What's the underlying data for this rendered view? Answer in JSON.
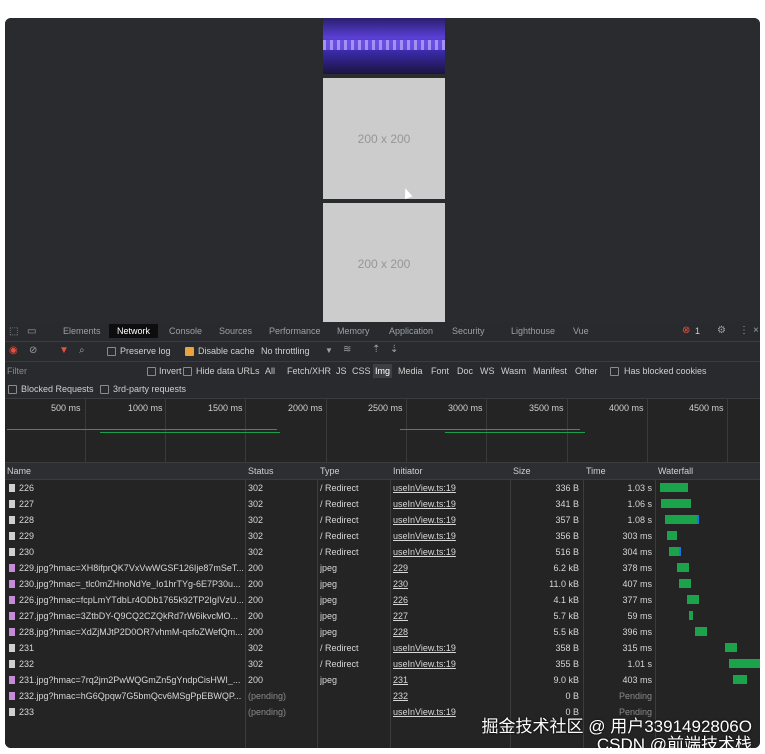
{
  "viewport": {
    "placeholder_1": "200 x 200",
    "placeholder_2": "200 x 200"
  },
  "devtools": {
    "tabs": [
      "Elements",
      "Network",
      "Console",
      "Sources",
      "Performance",
      "Memory",
      "Application",
      "Security",
      "Lighthouse",
      "Vue"
    ],
    "active_tab": "Network",
    "error_count": "1",
    "toolbar": {
      "preserve_log": "Preserve log",
      "disable_cache": "Disable cache",
      "throttling": "No throttling"
    },
    "filter": {
      "placeholder": "Filter",
      "invert": "Invert",
      "hide_data_urls": "Hide data URLs",
      "types": [
        "All",
        "Fetch/XHR",
        "JS",
        "CSS",
        "Img",
        "Media",
        "Font",
        "Doc",
        "WS",
        "Wasm",
        "Manifest",
        "Other"
      ],
      "active_type": "Img",
      "has_blocked_cookies": "Has blocked cookies",
      "blocked_requests": "Blocked Requests",
      "third_party": "3rd-party requests"
    },
    "overview_ticks": [
      "500 ms",
      "1000 ms",
      "1500 ms",
      "2000 ms",
      "2500 ms",
      "3000 ms",
      "3500 ms",
      "4000 ms",
      "4500 ms"
    ],
    "columns": {
      "name": "Name",
      "status": "Status",
      "type": "Type",
      "initiator": "Initiator",
      "size": "Size",
      "time": "Time",
      "waterfall": "Waterfall"
    },
    "rows": [
      {
        "name": "226",
        "status": "302",
        "type": "/ Redirect",
        "initiator": "useInView.ts:19",
        "size": "336 B",
        "time": "1.03 s",
        "icon": "document-icon"
      },
      {
        "name": "227",
        "status": "302",
        "type": "/ Redirect",
        "initiator": "useInView.ts:19",
        "size": "341 B",
        "time": "1.06 s",
        "icon": "document-icon"
      },
      {
        "name": "228",
        "status": "302",
        "type": "/ Redirect",
        "initiator": "useInView.ts:19",
        "size": "357 B",
        "time": "1.08 s",
        "icon": "document-icon"
      },
      {
        "name": "229",
        "status": "302",
        "type": "/ Redirect",
        "initiator": "useInView.ts:19",
        "size": "356 B",
        "time": "303 ms",
        "icon": "document-icon"
      },
      {
        "name": "230",
        "status": "302",
        "type": "/ Redirect",
        "initiator": "useInView.ts:19",
        "size": "516 B",
        "time": "304 ms",
        "icon": "document-icon"
      },
      {
        "name": "229.jpg?hmac=XH8ifprQK7VxVwWGSF126Ije87mSeT...",
        "status": "200",
        "type": "jpeg",
        "initiator": "229",
        "size": "6.2 kB",
        "time": "378 ms",
        "icon": "image-icon"
      },
      {
        "name": "230.jpg?hmac=_tlc0mZHnoNdYe_Io1hrTYg-6E7P30u...",
        "status": "200",
        "type": "jpeg",
        "initiator": "230",
        "size": "11.0 kB",
        "time": "407 ms",
        "icon": "image-icon"
      },
      {
        "name": "226.jpg?hmac=fcpLmYTdbLr4ODb1765k92TP2IgIVzU...",
        "status": "200",
        "type": "jpeg",
        "initiator": "226",
        "size": "4.1 kB",
        "time": "377 ms",
        "icon": "image-icon"
      },
      {
        "name": "227.jpg?hmac=3ZtbDY-Q9CQ2CZQkRd7rW6ikvcMO...",
        "status": "200",
        "type": "jpeg",
        "initiator": "227",
        "size": "5.7 kB",
        "time": "59 ms",
        "icon": "image-icon"
      },
      {
        "name": "228.jpg?hmac=XdZjMJtP2D0OR7vhmM-qsfoZWefQm...",
        "status": "200",
        "type": "jpeg",
        "initiator": "228",
        "size": "5.5 kB",
        "time": "396 ms",
        "icon": "image-icon"
      },
      {
        "name": "231",
        "status": "302",
        "type": "/ Redirect",
        "initiator": "useInView.ts:19",
        "size": "358 B",
        "time": "315 ms",
        "icon": "document-icon"
      },
      {
        "name": "232",
        "status": "302",
        "type": "/ Redirect",
        "initiator": "useInView.ts:19",
        "size": "355 B",
        "time": "1.01 s",
        "icon": "document-icon"
      },
      {
        "name": "231.jpg?hmac=7rq2jm2PwWQGmZn5gYndpCisHWI_...",
        "status": "200",
        "type": "jpeg",
        "initiator": "231",
        "size": "9.0 kB",
        "time": "403 ms",
        "icon": "image-icon"
      },
      {
        "name": "232.jpg?hmac=hG6Qpqw7G5bmQcv6MSgPpEBWQP...",
        "status": "(pending)",
        "type": "",
        "initiator": "232",
        "size": "0 B",
        "time": "Pending",
        "icon": "image-icon"
      },
      {
        "name": "233",
        "status": "(pending)",
        "type": "",
        "initiator": "useInView.ts:19",
        "size": "0 B",
        "time": "Pending",
        "icon": "document-icon"
      }
    ]
  },
  "watermark": {
    "line1": "掘金技术社区 @ 用户3391492806O",
    "line2": "CSDN @前端技术栈"
  },
  "colors": {
    "devtools_bg": "#242424",
    "waterfall_green": "#1aa34a",
    "waterfall_blue": "#1a73e8",
    "record_red": "#e94e3c",
    "checkbox_orange": "#e8a33d"
  }
}
